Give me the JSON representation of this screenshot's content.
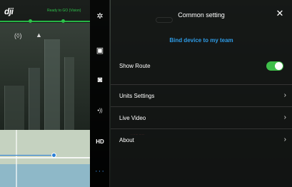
{
  "app": {
    "logo_text": "dji",
    "status_text": "Ready to GO (Vision)"
  },
  "tools": [
    {
      "name": "aircraft-icon",
      "glyph": "✲"
    },
    {
      "name": "camera-icon",
      "glyph": "▣"
    },
    {
      "name": "remote-controller-icon",
      "glyph": "◙"
    },
    {
      "name": "signal-icon",
      "glyph": "•))"
    },
    {
      "name": "hd-label",
      "glyph": "HD"
    },
    {
      "name": "more-icon",
      "glyph": "···"
    }
  ],
  "panel": {
    "title": "Common setting",
    "close_glyph": "✕",
    "bind_link": "Bind device to my team",
    "items": [
      {
        "label": "Show Route",
        "type": "toggle",
        "checked": true
      },
      {
        "label": "Units Settings",
        "type": "link"
      },
      {
        "label": "Live Video",
        "type": "link"
      },
      {
        "label": "About",
        "type": "link"
      }
    ],
    "chevron": "›"
  },
  "colors": {
    "accent_blue": "#2e9be6",
    "toggle_on": "#3fbf4a",
    "status_green": "#2ec24b"
  }
}
